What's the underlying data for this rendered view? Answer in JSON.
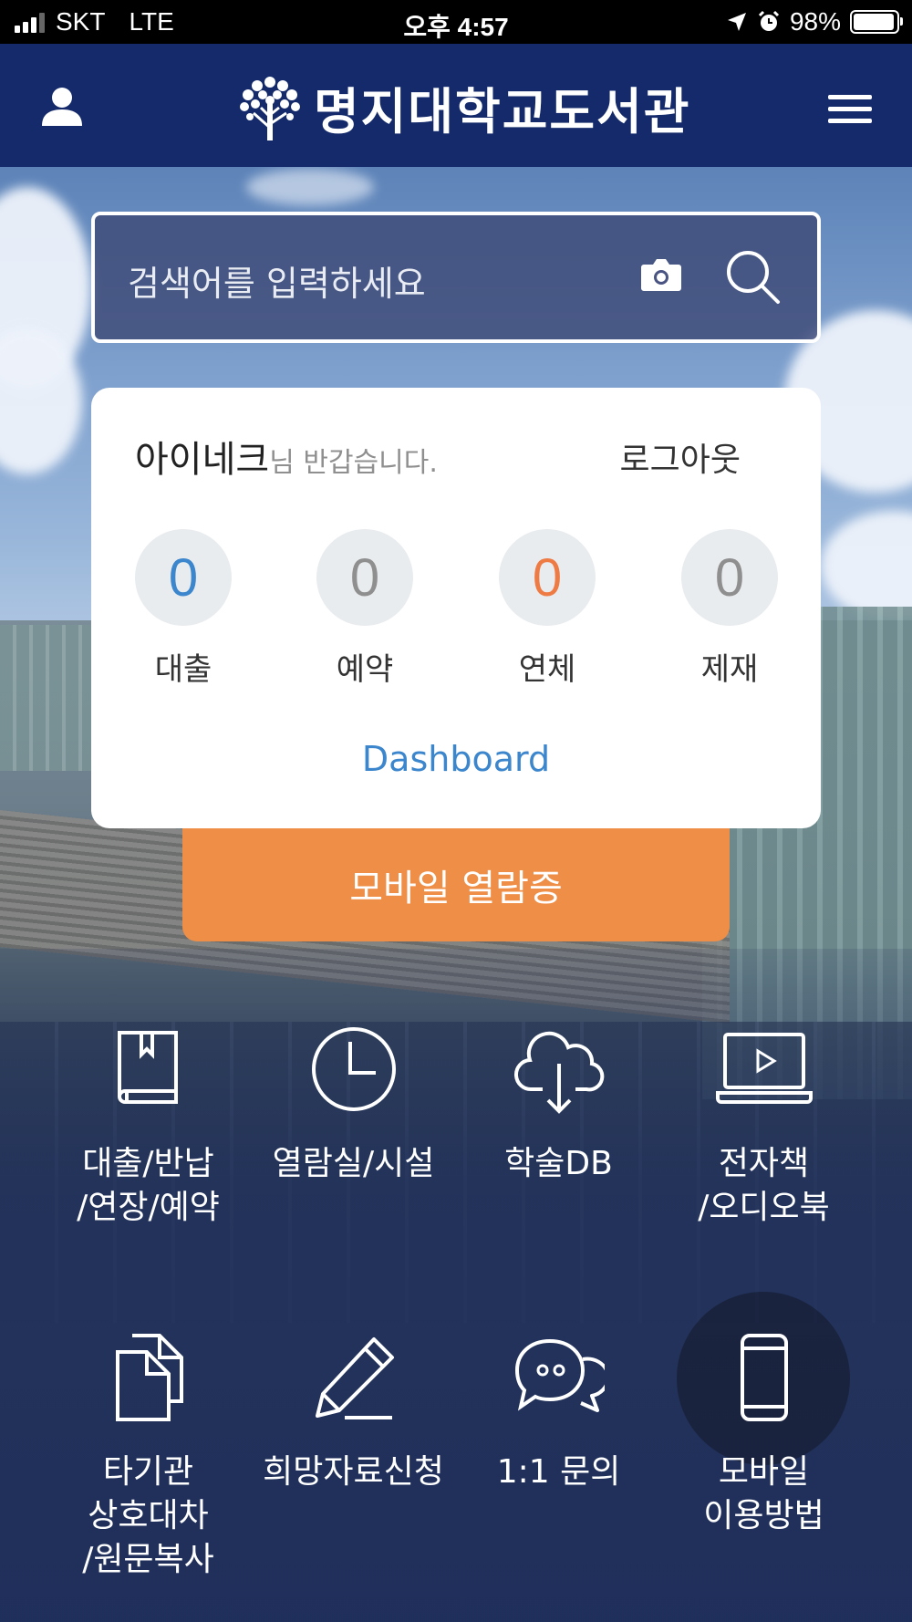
{
  "status_bar": {
    "carrier": "SKT",
    "network": "LTE",
    "time": "오후 4:57",
    "battery": "98%",
    "battery_level": 0.98
  },
  "header": {
    "title": "명지대학교도서관",
    "user_icon": "user-icon",
    "menu_icon": "hamburger-menu-icon"
  },
  "search": {
    "placeholder": "검색어를 입력하세요"
  },
  "user_card": {
    "name": "아이네크",
    "greeting_suffix": "님 반갑습니다.",
    "logout": "로그아웃",
    "stats": [
      {
        "value": "0",
        "label": "대출",
        "color": "#3b86cc"
      },
      {
        "value": "0",
        "label": "예약",
        "color": "#8f8f8f"
      },
      {
        "value": "0",
        "label": "연체",
        "color": "#ee7a44"
      },
      {
        "value": "0",
        "label": "제재",
        "color": "#8f8f8f"
      }
    ],
    "dashboard": "Dashboard"
  },
  "mobile_pass": {
    "label": "모바일 열람증",
    "color": "#ee8e47"
  },
  "menu_grid": [
    {
      "line1": "대출/반납",
      "line2": "/연장/예약",
      "line3": "",
      "icon": "book-icon"
    },
    {
      "line1": "열람실/시설",
      "line2": "",
      "line3": "",
      "icon": "clock-icon"
    },
    {
      "line1": "학술DB",
      "line2": "",
      "line3": "",
      "icon": "cloud-download-icon"
    },
    {
      "line1": "전자책",
      "line2": "/오디오북",
      "line3": "",
      "icon": "laptop-play-icon"
    },
    {
      "line1": "타기관",
      "line2": "상호대차",
      "line3": "/원문복사",
      "icon": "document-copy-icon"
    },
    {
      "line1": "희망자료신청",
      "line2": "",
      "line3": "",
      "icon": "pencil-icon"
    },
    {
      "line1": "1:1 문의",
      "line2": "",
      "line3": "",
      "icon": "chat-bubbles-icon"
    },
    {
      "line1": "모바일",
      "line2": "이용방법",
      "line3": "",
      "icon": "smartphone-icon"
    }
  ]
}
